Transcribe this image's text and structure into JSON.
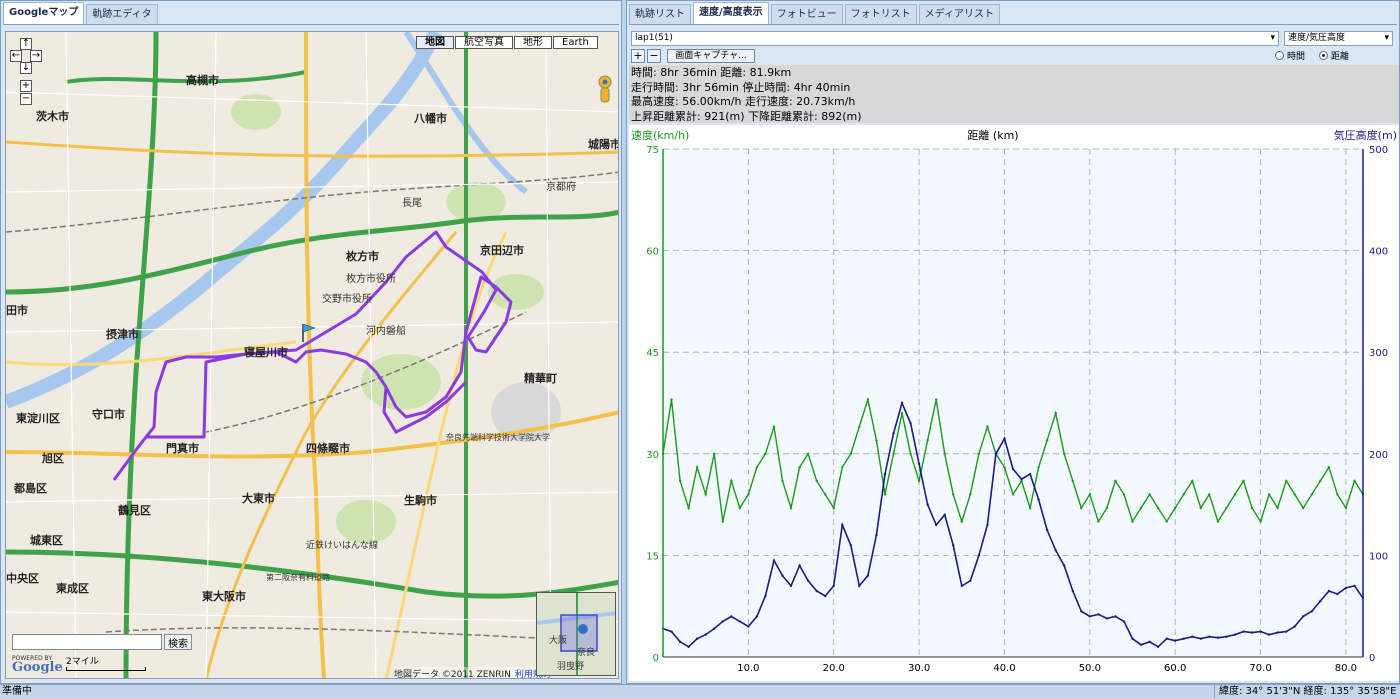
{
  "left_tabs": [
    "Googleマップ",
    "軌跡エディタ"
  ],
  "map": {
    "types": [
      "地図",
      "航空写真",
      "地形",
      "Earth"
    ],
    "search_button": "検索",
    "search_value": "",
    "scale_label": "2マイル",
    "powered_by": "POWERED BY",
    "google_logo": "Google",
    "copyright": "地図データ ©2011 ZENRIN",
    "copyright_link": "利用規約",
    "labels": [
      {
        "text": "高槻市",
        "city": true
      },
      {
        "text": "茨木市",
        "city": true
      },
      {
        "text": "八幡市",
        "city": true
      },
      {
        "text": "城陽市",
        "city": true
      },
      {
        "text": "枚方市",
        "city": true
      },
      {
        "text": "京田辺市",
        "city": true
      },
      {
        "text": "摂津市",
        "city": true
      },
      {
        "text": "寝屋川市",
        "city": true
      },
      {
        "text": "精華町",
        "city": true
      },
      {
        "text": "守口市",
        "city": true
      },
      {
        "text": "門真市",
        "city": true
      },
      {
        "text": "四條畷市",
        "city": true
      },
      {
        "text": "東淀川区",
        "city": true
      },
      {
        "text": "旭区",
        "city": true
      },
      {
        "text": "都島区",
        "city": true
      },
      {
        "text": "鶴見区",
        "city": true
      },
      {
        "text": "大東市",
        "city": true
      },
      {
        "text": "生駒市",
        "city": true
      },
      {
        "text": "城東区",
        "city": true
      },
      {
        "text": "東成区",
        "city": true
      },
      {
        "text": "東大阪市",
        "city": true
      },
      {
        "text": "中央区",
        "city": true
      },
      {
        "text": "田市",
        "city": true
      },
      {
        "text": "長尾",
        "city": false
      },
      {
        "text": "交野市役所",
        "city": false
      },
      {
        "text": "河内磐船",
        "city": false
      },
      {
        "text": "枚方市役所",
        "city": false
      },
      {
        "text": "京都府",
        "city": false
      },
      {
        "text": "奈良先端科学技術大学院大学",
        "city": false
      },
      {
        "text": "近鉄けいはんな線",
        "city": false
      },
      {
        "text": "第二阪奈有料道路",
        "city": false
      }
    ],
    "overview_labels": [
      "大阪",
      "奈良",
      "羽曳野"
    ]
  },
  "right_tabs": [
    "軌跡リスト",
    "速度/高度表示",
    "フォトビュー",
    "フォトリスト",
    "メディアリスト"
  ],
  "lap_select": "lap1(51)",
  "graph_select": "速度/気圧高度",
  "toolbar": {
    "zoom_in": "+",
    "zoom_out": "−",
    "capture": "画面キャプチャ..."
  },
  "radio": [
    {
      "label": "時間",
      "selected": false
    },
    {
      "label": "距離",
      "selected": true
    }
  ],
  "stats": [
    "時間: 8hr 36min  距離: 81.9km",
    "走行時間: 3hr 56min  停止時間: 4hr 40min",
    "最高速度: 56.00km/h  走行速度: 20.73km/h",
    "上昇距離累計: 921(m)  下降距離累計: 892(m)"
  ],
  "colors": {
    "speed": "#1a9a1a",
    "altitude": "#1a1a8a",
    "route": "#8a3ae0"
  },
  "chart_data": {
    "type": "line",
    "xlabel": "距離 (km)",
    "y_left_label": "速度(km/h)",
    "y_right_label": "気圧高度(m)",
    "xlim": [
      0,
      82
    ],
    "ylim_left": [
      0,
      75
    ],
    "ylim_right": [
      0,
      500
    ],
    "x_ticks": [
      "10.0",
      "20.0",
      "30.0",
      "40.0",
      "50.0",
      "60.0",
      "70.0",
      "80.0"
    ],
    "y_left_ticks": [
      "0",
      "15",
      "30",
      "45",
      "60",
      "75"
    ],
    "y_right_ticks": [
      "0",
      "100",
      "200",
      "300",
      "400",
      "500"
    ],
    "series": [
      {
        "name": "速度(km/h)",
        "axis": "left",
        "x": [
          0,
          1,
          2,
          3,
          4,
          5,
          6,
          7,
          8,
          9,
          10,
          11,
          12,
          13,
          14,
          15,
          16,
          17,
          18,
          19,
          20,
          21,
          22,
          23,
          24,
          25,
          26,
          27,
          28,
          29,
          30,
          31,
          32,
          33,
          34,
          35,
          36,
          37,
          38,
          39,
          40,
          41,
          42,
          43,
          44,
          45,
          46,
          47,
          48,
          49,
          50,
          51,
          52,
          53,
          54,
          55,
          56,
          57,
          58,
          59,
          60,
          61,
          62,
          63,
          64,
          65,
          66,
          67,
          68,
          69,
          70,
          71,
          72,
          73,
          74,
          75,
          76,
          77,
          78,
          79,
          80,
          81,
          82
        ],
        "values": [
          30,
          38,
          26,
          22,
          28,
          24,
          30,
          20,
          26,
          22,
          24,
          28,
          30,
          34,
          26,
          22,
          28,
          30,
          26,
          24,
          22,
          28,
          30,
          34,
          38,
          32,
          24,
          30,
          36,
          30,
          26,
          32,
          38,
          30,
          24,
          20,
          24,
          30,
          34,
          30,
          28,
          24,
          26,
          22,
          28,
          32,
          36,
          30,
          26,
          22,
          24,
          20,
          22,
          26,
          24,
          20,
          22,
          24,
          22,
          20,
          22,
          24,
          26,
          22,
          24,
          20,
          22,
          24,
          26,
          22,
          20,
          24,
          22,
          26,
          24,
          22,
          24,
          26,
          28,
          24,
          22,
          26,
          24
        ]
      },
      {
        "name": "気圧高度(m)",
        "axis": "right",
        "x": [
          0,
          1,
          2,
          3,
          4,
          5,
          6,
          7,
          8,
          9,
          10,
          11,
          12,
          13,
          14,
          15,
          16,
          17,
          18,
          19,
          20,
          21,
          22,
          23,
          24,
          25,
          26,
          27,
          28,
          29,
          30,
          31,
          32,
          33,
          34,
          35,
          36,
          37,
          38,
          39,
          40,
          41,
          42,
          43,
          44,
          45,
          46,
          47,
          48,
          49,
          50,
          51,
          52,
          53,
          54,
          55,
          56,
          57,
          58,
          59,
          60,
          61,
          62,
          63,
          64,
          65,
          66,
          67,
          68,
          69,
          70,
          71,
          72,
          73,
          74,
          75,
          76,
          77,
          78,
          79,
          80,
          81,
          82
        ],
        "values": [
          28,
          25,
          15,
          10,
          18,
          22,
          28,
          35,
          40,
          35,
          30,
          40,
          60,
          95,
          80,
          70,
          90,
          75,
          65,
          60,
          70,
          130,
          110,
          70,
          80,
          120,
          180,
          220,
          250,
          230,
          190,
          150,
          130,
          140,
          110,
          70,
          75,
          100,
          130,
          200,
          215,
          185,
          175,
          180,
          155,
          125,
          105,
          90,
          65,
          45,
          40,
          42,
          38,
          40,
          35,
          18,
          12,
          15,
          10,
          18,
          16,
          18,
          20,
          18,
          20,
          19,
          20,
          22,
          25,
          24,
          25,
          22,
          24,
          25,
          30,
          40,
          45,
          55,
          65,
          62,
          68,
          70,
          58
        ]
      }
    ]
  },
  "status": {
    "left": "準備中",
    "right": "緯度: 34° 51'3\"N  経度: 135° 35'58\"E"
  }
}
